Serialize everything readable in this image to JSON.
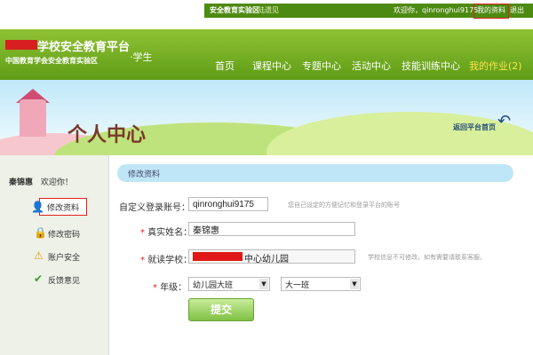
{
  "top_bar": {
    "lab_label": "安全教育实验区",
    "lab_link": "陆遗见",
    "welcome": "欢迎你，qinronghui9175",
    "profile_link": "我的资料",
    "logout": "退出"
  },
  "brand": {
    "title": "学校安全教育平台",
    "subtitle": "中国教育学会安全教育实验区",
    "role": "·学生"
  },
  "nav": [
    {
      "label": "首页"
    },
    {
      "label": "课程中心"
    },
    {
      "label": "专题中心"
    },
    {
      "label": "活动中心"
    },
    {
      "label": "技能训练中心"
    },
    {
      "label": "我的作业(2)"
    }
  ],
  "banner": {
    "title": "个人中心",
    "back_link": "返回平台首页"
  },
  "sidebar": {
    "user_name": "秦锦惠",
    "greeting": "欢迎你！",
    "items": [
      {
        "label": "修改资料",
        "icon": "user-icon"
      },
      {
        "label": "修改密码",
        "icon": "lock-icon"
      },
      {
        "label": "账户安全",
        "icon": "warning-icon"
      },
      {
        "label": "反馈意见",
        "icon": "feedback-icon"
      }
    ]
  },
  "form": {
    "section_title": "修改资料",
    "account_label": "自定义登录账号：",
    "account_value": "qinronghui9175",
    "account_hint": "您自己设定的方便记忆和登录平台的账号",
    "name_label": "真实姓名：",
    "name_value": "秦锦惠",
    "school_label": "就读学校：",
    "school_value": "中心幼儿园",
    "school_hint": "学校信息不可修改，如有需要请联系客服。",
    "grade_label": "年级：",
    "grade_value": "幼儿园大班",
    "class_value": "大一班",
    "submit_label": "提交"
  },
  "colors": {
    "header_green": "#6aab1e",
    "accent_red": "#e0201c",
    "section_blue": "#bfe6f6"
  }
}
